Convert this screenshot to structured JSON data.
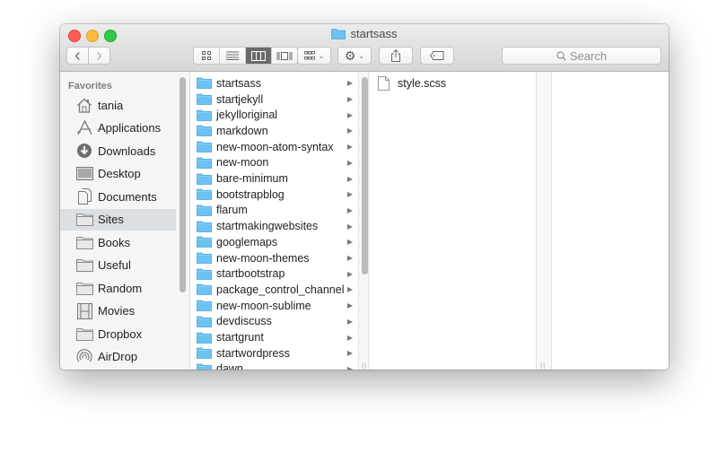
{
  "window": {
    "title": "startsass",
    "title_icon": "folder-icon"
  },
  "toolbar": {
    "back_icon": "‹",
    "forward_icon": "›",
    "view_modes": [
      {
        "name": "icon-view",
        "active": false
      },
      {
        "name": "list-view",
        "active": false
      },
      {
        "name": "column-view",
        "active": true
      },
      {
        "name": "cover-flow-view",
        "active": false
      }
    ],
    "arrange_icon": "grid-icon",
    "action_icon": "gear-icon",
    "share_icon": "share-icon",
    "tags_icon": "tag-icon",
    "search_placeholder": "Search"
  },
  "sidebar": {
    "heading": "Favorites",
    "items": [
      {
        "label": "tania",
        "icon": "home-icon",
        "selected": false
      },
      {
        "label": "Applications",
        "icon": "applications-icon",
        "selected": false
      },
      {
        "label": "Downloads",
        "icon": "downloads-icon",
        "selected": false
      },
      {
        "label": "Desktop",
        "icon": "desktop-icon",
        "selected": false
      },
      {
        "label": "Documents",
        "icon": "documents-icon",
        "selected": false
      },
      {
        "label": "Sites",
        "icon": "folder-icon",
        "selected": true
      },
      {
        "label": "Books",
        "icon": "folder-icon",
        "selected": false
      },
      {
        "label": "Useful",
        "icon": "folder-icon",
        "selected": false
      },
      {
        "label": "Random",
        "icon": "folder-icon",
        "selected": false
      },
      {
        "label": "Movies",
        "icon": "movies-icon",
        "selected": false
      },
      {
        "label": "Dropbox",
        "icon": "folder-icon",
        "selected": false
      },
      {
        "label": "AirDrop",
        "icon": "airdrop-icon",
        "selected": false
      }
    ]
  },
  "columns": {
    "col1": [
      "startsass",
      "startjekyll",
      "jekylloriginal",
      "markdown",
      "new-moon-atom-syntax",
      "new-moon",
      "bare-minimum",
      "bootstrapblog",
      "flarum",
      "startmakingwebsites",
      "googlemaps",
      "new-moon-themes",
      "startbootstrap",
      "package_control_channel",
      "new-moon-sublime",
      "devdiscuss",
      "startgrunt",
      "startwordpress",
      "dawn"
    ],
    "col2": [
      "style.scss"
    ],
    "col3": []
  },
  "colors": {
    "folder_blue": "#6cc3f2",
    "selected_sidebar": "#dcdfe3",
    "close": "#fc5f57",
    "minimize": "#fdbc40",
    "maximize": "#34c84a"
  }
}
